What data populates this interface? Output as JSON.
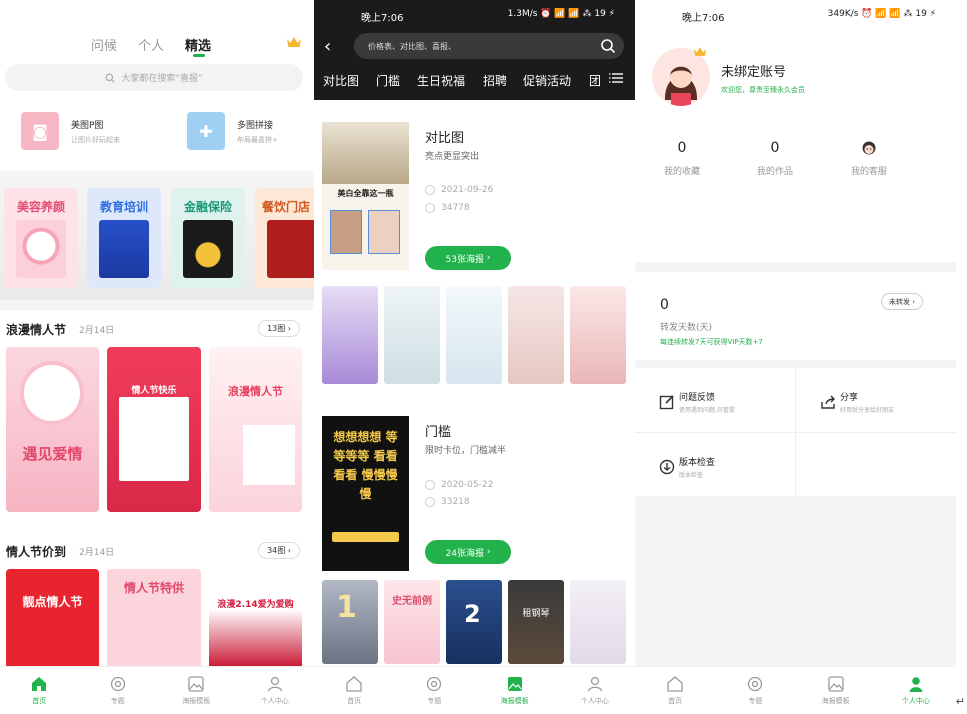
{
  "colors": {
    "accent": "#22b24c",
    "dark_header": "#1b1b1b",
    "pink": "#ff6b8a",
    "red": "#e8343f"
  },
  "screen1": {
    "tabs": [
      "问候",
      "个人",
      "精选"
    ],
    "search_placeholder": "大家都在搜索“喜报”",
    "tools": [
      {
        "title": "美图P图",
        "sub": "让图片好玩起来"
      },
      {
        "title": "多图拼接",
        "sub": "布局最喜拼+"
      }
    ],
    "categories": [
      "美容养颜",
      "教育培训",
      "金融保险",
      "餐饮门店"
    ],
    "sections": [
      {
        "title": "浪漫情人节",
        "date": "2月14日",
        "count": "13图"
      },
      {
        "title": "情人节价到",
        "date": "2月14日",
        "count": "34图"
      }
    ],
    "posters_row1": [
      "遇见爱情",
      "情人节快乐",
      "浪漫情人节"
    ],
    "posters_row2": [
      "靓点情人节",
      "情人节特供",
      "浪漫2.14爱为爱购"
    ]
  },
  "screen2": {
    "status_time": "晚上7:06",
    "status_right": "1.3M/s ⏰ 📶 📶 ⁂ 19 ⚡",
    "search_placeholder": "价格表、对比图、喜报、",
    "tabs": [
      "对比图",
      "门槛",
      "生日祝福",
      "招聘",
      "促销活动",
      "团"
    ],
    "cards": [
      {
        "title": "对比图",
        "sub": "亮点更显突出",
        "date": "2021-09-26",
        "views": "34778",
        "button": "53张海报",
        "cover_text": "美白全靠这一瓶"
      },
      {
        "title": "门槛",
        "sub": "限时卡位，门槛减半",
        "date": "2020-05-22",
        "views": "33218",
        "button": "24张海报",
        "cover_text": "想想想想 等等等等 看看看看 慢慢慢慢"
      }
    ],
    "thumbs_row2": [
      "1",
      "史无前例",
      "2",
      "租钢琴",
      ""
    ]
  },
  "screen3": {
    "status_time": "晚上7:06",
    "status_right": "349K/s ⏰ 📶 📶 ⁂ 19 ⚡",
    "account_name": "未绑定账号",
    "account_sub": "欢迎您，尊贵至臻永久会员",
    "stats": [
      {
        "num": "0",
        "label": "我的收藏"
      },
      {
        "num": "0",
        "label": "我的作品"
      },
      {
        "num": "",
        "label": "我的客服"
      }
    ],
    "forward": {
      "num": "0",
      "label": "转发天数(天)",
      "green": "每连续转发7天可获得VIP天数+7",
      "button": "未转发"
    },
    "menus": [
      {
        "title": "问题反馈",
        "sub": "使用遇到问题,尽管提"
      },
      {
        "title": "分享",
        "sub": "好用就分享给好朋友"
      },
      {
        "title": "版本检查",
        "sub": "版本检查"
      }
    ]
  },
  "nav": [
    "首页",
    "专题",
    "海报模板",
    "个人中心"
  ]
}
